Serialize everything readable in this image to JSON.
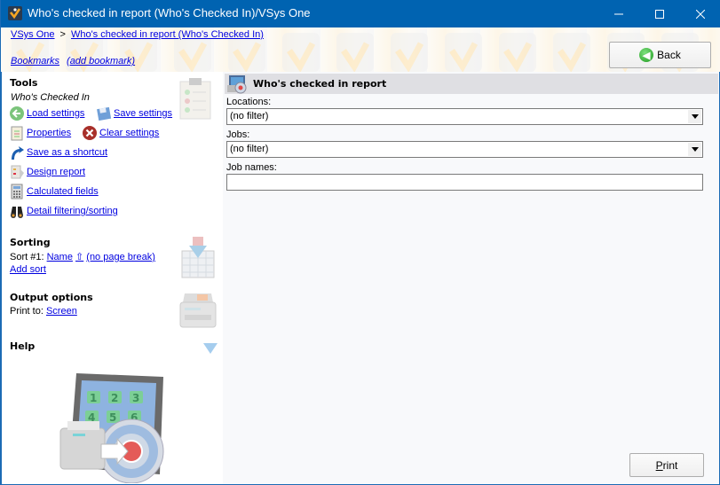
{
  "window": {
    "title": "Who's checked in report (Who's Checked In)/VSys One",
    "controls": {
      "minimize": "—",
      "maximize": "☐",
      "close": "✕"
    }
  },
  "breadcrumb": {
    "items": [
      "VSys One",
      "Who's checked in report (Who's Checked In)"
    ],
    "separator": ">"
  },
  "bookmarks": {
    "label": "Bookmarks",
    "add_label": "(add bookmark)"
  },
  "back_button": {
    "label": "Back"
  },
  "tools": {
    "title": "Tools",
    "subtitle": "Who's Checked In",
    "items": {
      "load_settings": "Load settings",
      "save_settings": "Save settings",
      "properties": "Properties",
      "clear_settings": "Clear settings",
      "save_shortcut": "Save as a shortcut",
      "design_report": "Design report",
      "calculated_fields": "Calculated fields",
      "detail_filtering": "Detail filtering/sorting"
    }
  },
  "sorting": {
    "title": "Sorting",
    "sort1_label": "Sort #1:",
    "sort1_field": "Name",
    "sort1_direction_icon": "⇧",
    "sort1_break": "(no page break)",
    "add_sort": "Add sort"
  },
  "output": {
    "title": "Output options",
    "print_to_label": "Print to:",
    "print_to_value": "Screen"
  },
  "help": {
    "title": "Help"
  },
  "report": {
    "title": "Who's checked in report",
    "fields": {
      "locations": {
        "label": "Locations:",
        "value": "(no filter)"
      },
      "jobs": {
        "label": "Jobs:",
        "value": "(no filter)"
      },
      "job_names": {
        "label": "Job names:",
        "value": ""
      }
    }
  },
  "print_button": {
    "label_accel": "P",
    "label_rest": "rint"
  },
  "help_image_digits": [
    "1",
    "2",
    "3",
    "4",
    "5",
    "6"
  ]
}
